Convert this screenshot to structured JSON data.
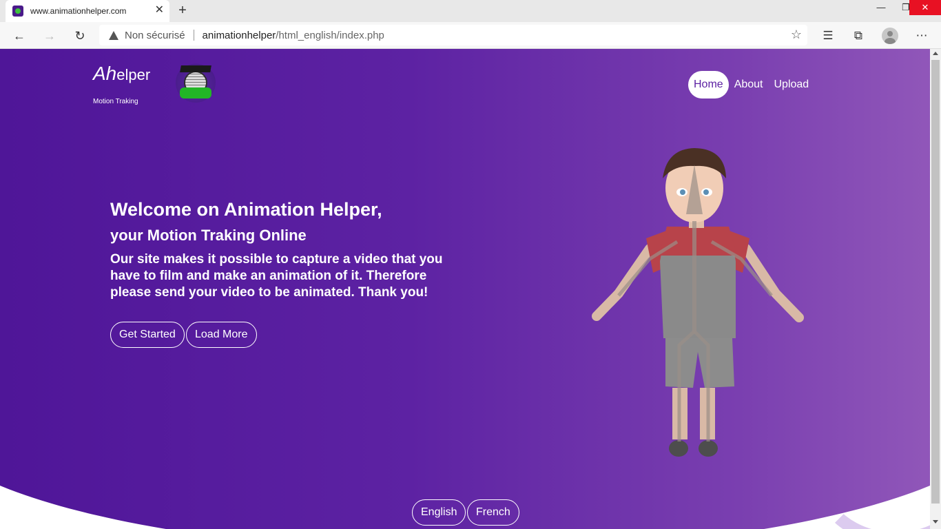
{
  "browser": {
    "tab_title": "www.animationhelper.com",
    "tab_close": "✕",
    "new_tab": "+",
    "win_min": "—",
    "win_max": "❐",
    "win_close": "✕",
    "back": "←",
    "forward": "→",
    "reload": "↻",
    "security_label": "Non sécurisé",
    "url_host": "animationhelper",
    "url_path": "/html_english/index.php",
    "star": "☆",
    "favorites": "☰",
    "collections": "⧉",
    "more": "⋯"
  },
  "brand": {
    "logo_big": "Ah",
    "logo_small": "elper",
    "tagline": "Motion Traking"
  },
  "menu": {
    "items": [
      {
        "label": "Home",
        "active": true
      },
      {
        "label": "About",
        "active": false
      },
      {
        "label": "Upload",
        "active": false
      }
    ]
  },
  "hero": {
    "title": "Welcome on Animation Helper,",
    "subtitle": "your Motion Traking Online",
    "description": "Our site makes it possible to capture a video that you have to film and make an animation of it. Therefore please send your video to be animated. Thank you!",
    "btn_start": "Get Started",
    "btn_more": "Load More"
  },
  "languages": {
    "english": "English",
    "french": "French"
  },
  "colors": {
    "hero_start": "#4c1396",
    "hero_end": "#9a61bd",
    "close_red": "#e81123",
    "active_text": "#5b1fa2"
  }
}
